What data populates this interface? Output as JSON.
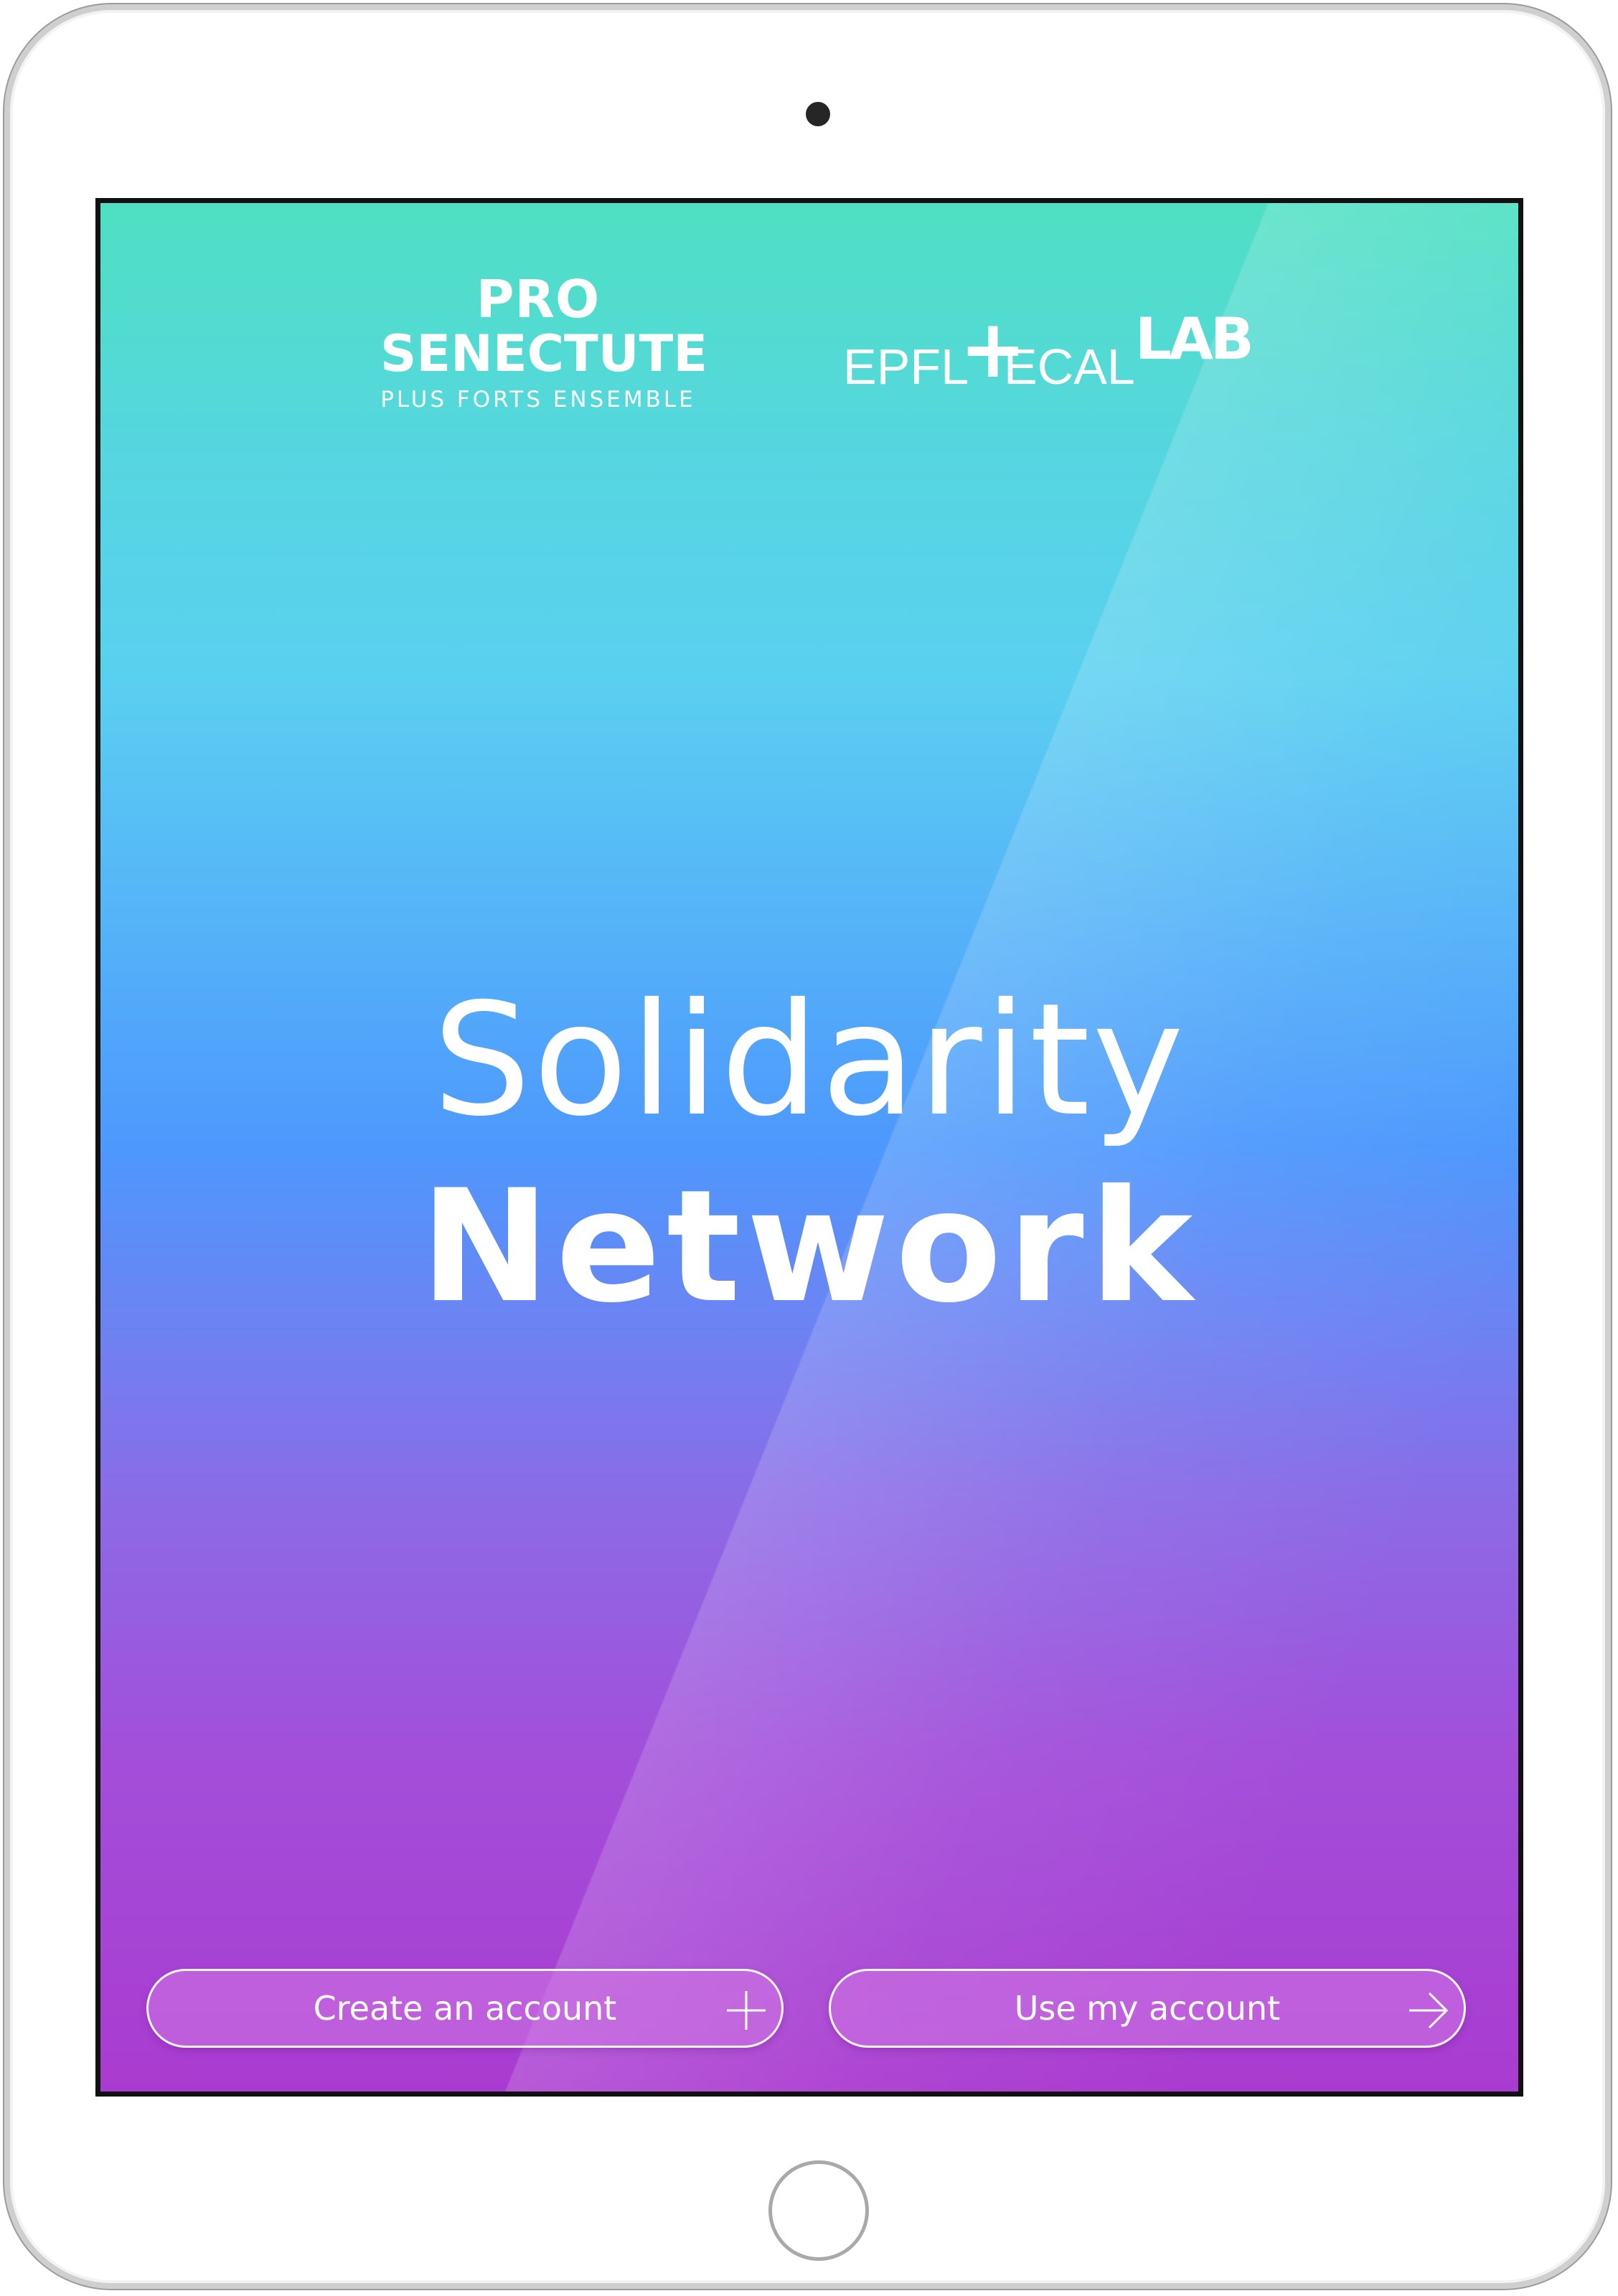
{
  "brand": {
    "pro_senectute": {
      "line1": "PRO",
      "line2": "SENECTUTE",
      "tagline": "PLUS FORTS ENSEMBLE"
    },
    "epfl_ecal": {
      "epfl": "EPFL",
      "plus": "+",
      "ecal": "ECAL",
      "lab": "LAB"
    }
  },
  "title": {
    "line1": "Solidarity",
    "line2": "Network"
  },
  "actions": {
    "create": {
      "label": "Create an account",
      "icon": "plus-icon"
    },
    "use": {
      "label": "Use my account",
      "icon": "arrow-right-icon"
    }
  },
  "colors": {
    "gradient_top": "#4fe0c2",
    "gradient_middle": "#4d98fd",
    "gradient_bottom": "#aa3bd0",
    "text": "#ffffff"
  }
}
